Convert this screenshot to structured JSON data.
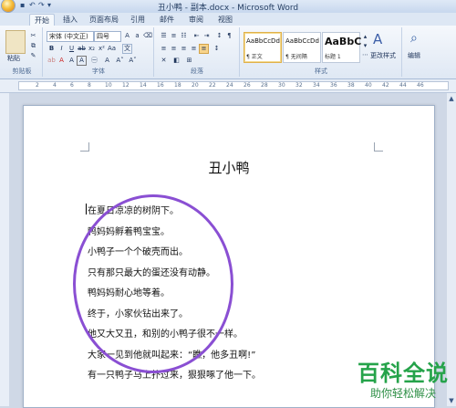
{
  "window": {
    "title": "丑小鸭 - 副本.docx - Microsoft Word"
  },
  "ribbon_tabs": [
    "开始",
    "插入",
    "页面布局",
    "引用",
    "邮件",
    "审阅",
    "视图"
  ],
  "ribbon": {
    "clipboard": {
      "paste_label": "粘贴",
      "group_label": "剪贴板"
    },
    "font": {
      "font_name": "宋体 (中文正)",
      "font_size": "四号",
      "group_label": "字体"
    },
    "paragraph": {
      "group_label": "段落"
    },
    "styles": {
      "items": [
        {
          "sample": "AaBbCcDd",
          "label": "¶ 正文"
        },
        {
          "sample": "AaBbCcDd",
          "label": "¶ 无间隔"
        },
        {
          "sample": "AaBbC",
          "label": "标题 1"
        }
      ],
      "change_label": "更改样式",
      "group_label": "样式"
    },
    "editing": {
      "label": "编辑"
    }
  },
  "ruler": {
    "marks": [
      "2",
      "4",
      "6",
      "8",
      "10",
      "12",
      "14",
      "16",
      "18",
      "20",
      "22",
      "24",
      "26",
      "28",
      "30",
      "32",
      "34",
      "36",
      "38",
      "40",
      "42",
      "44",
      "46"
    ]
  },
  "document": {
    "title": "丑小鸭",
    "lines": [
      "在夏日凉凉的树阴下。",
      "鸭妈妈孵着鸭宝宝。",
      "小鸭子一个个破壳而出。",
      "只有那只最大的蛋还没有动静。",
      "鸭妈妈耐心地等着。",
      "终于，小家伙钻出来了。",
      "他又大又丑，和别的小鸭子很不一样。",
      "大家一见到他就叫起来：“瞧，他多丑啊!”",
      "有一只鸭子马上扑过来，狠狠啄了他一下。"
    ]
  },
  "watermark": {
    "main": "百科全说",
    "sub": "助你轻松解决"
  },
  "colors": {
    "annotation_circle": "#8a4fd3",
    "watermark_green": "#25a34a"
  }
}
